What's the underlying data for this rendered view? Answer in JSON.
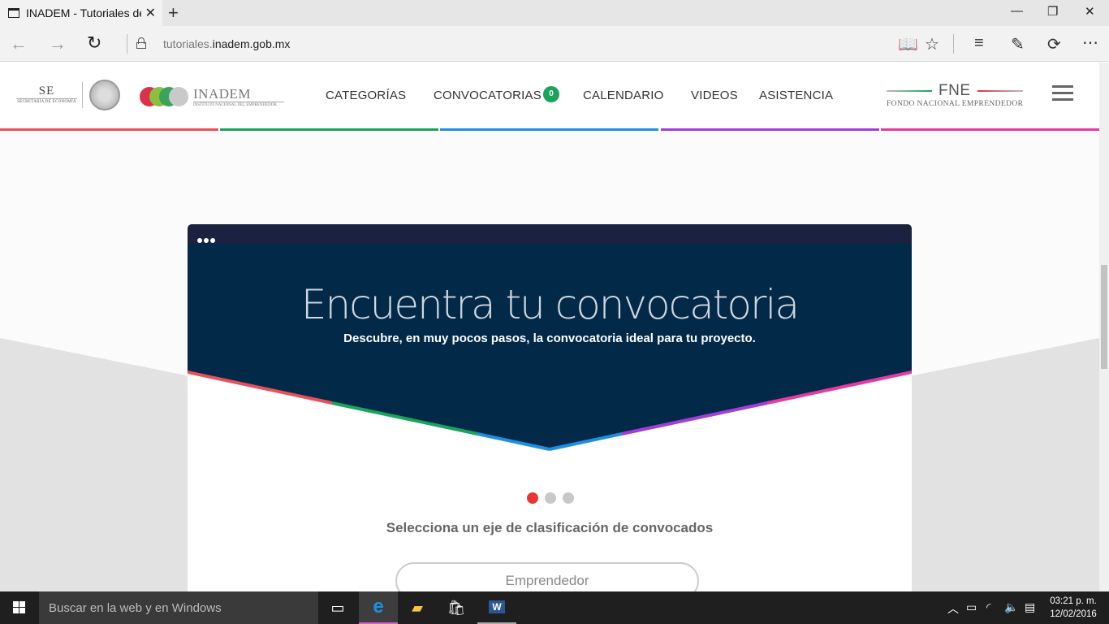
{
  "browser": {
    "tab_title": "INADEM - Tutoriales del",
    "url_prefix": "tutoriales.",
    "url_domain": "inadem.gob.mx",
    "icons": [
      "tab-page-icon",
      "close-icon",
      "new-tab-icon",
      "minimize-icon",
      "maximize-icon",
      "window-close-icon",
      "back-icon",
      "forward-icon",
      "refresh-icon",
      "lock-icon",
      "reading-view-icon",
      "favorite-star-icon",
      "hub-icon",
      "web-note-icon",
      "share-icon",
      "more-icon"
    ]
  },
  "site": {
    "logos": {
      "se_big": "SE",
      "se_small": "SECRETARÍA DE ECONOMÍA",
      "inadem_name": "INADEM",
      "inadem_sub": "INSTITUTO NACIONAL DEL EMPRENDEDOR",
      "fne_title": "FNE",
      "fne_sub": "FONDO NACIONAL EMPRENDEDOR"
    },
    "menu": [
      {
        "label": "CATEGORÍAS"
      },
      {
        "label": "CONVOCATORIAS",
        "badge": "0"
      },
      {
        "label": "CALENDARIO"
      },
      {
        "label": "VIDEOS"
      },
      {
        "label": "ASISTENCIA"
      }
    ],
    "strip_colors": [
      "#e8505b",
      "#1aa35c",
      "#1e8fe0",
      "#a23ed6",
      "#e63aa3"
    ]
  },
  "hero": {
    "title": "Encuentra tu convocatoria",
    "subtitle": "Descubre, en muy pocos pasos, la convocatoria ideal para tu proyecto.",
    "background": "#022a48"
  },
  "carousel": {
    "dots": 3,
    "active_index": 0,
    "active_color": "#e9353a",
    "inactive_color": "#c8c8c8"
  },
  "classification": {
    "prompt": "Selecciona un eje de clasificación de convocados",
    "option": "Emprendedor"
  },
  "taskbar": {
    "search_placeholder": "Buscar en la web y en Windows",
    "time": "03:21 p. m.",
    "date": "12/02/2016",
    "icons": [
      "windows-start-icon",
      "task-view-icon",
      "edge-browser-icon",
      "file-explorer-icon",
      "store-icon",
      "word-icon",
      "tray-up-arrow-icon",
      "battery-icon",
      "wifi-icon",
      "volume-icon",
      "notifications-icon"
    ]
  }
}
